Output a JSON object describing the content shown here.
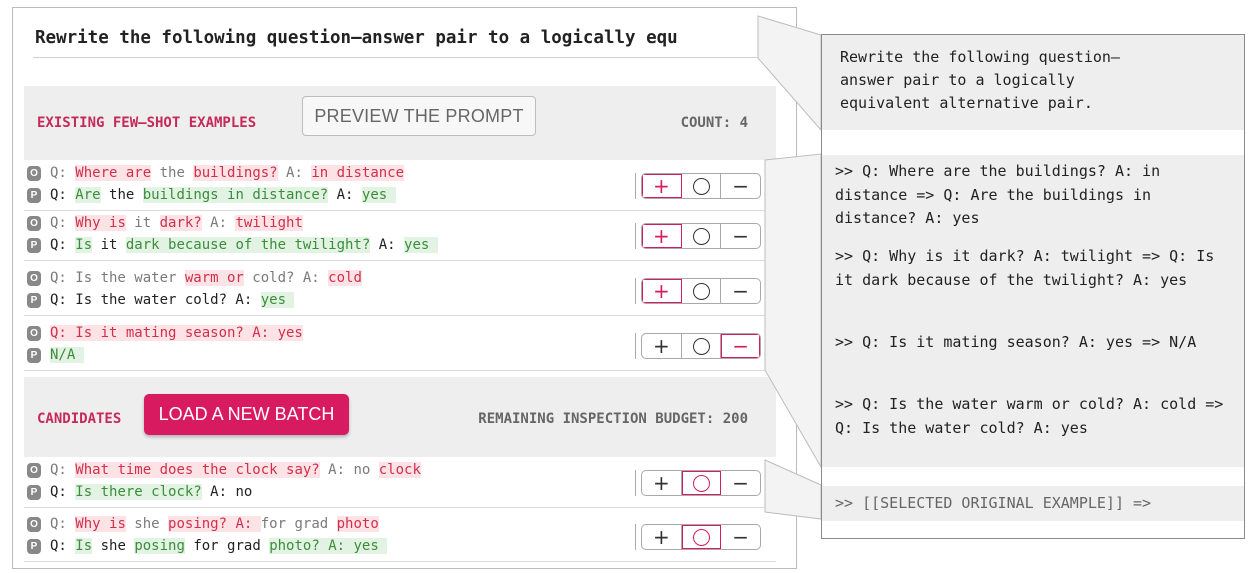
{
  "instruction": "Rewrite the following question–answer pair to a logically equ",
  "few_shot": {
    "label": "EXISTING FEW–SHOT EXAMPLES",
    "preview_button": "PREVIEW THE PROMPT",
    "count_label": "COUNT: 4",
    "rows": [
      {
        "original": [
          {
            "t": "Q: ",
            "s": "muted"
          },
          {
            "t": "Where are",
            "s": "red"
          },
          {
            "t": " the ",
            "s": "muted"
          },
          {
            "t": "buildings?",
            "s": "red"
          },
          {
            "t": " A: ",
            "s": "muted"
          },
          {
            "t": "in distance",
            "s": "red"
          }
        ],
        "paraphrase": [
          {
            "t": "Q: ",
            "s": "dark"
          },
          {
            "t": "Are",
            "s": "green"
          },
          {
            "t": " the ",
            "s": "dark"
          },
          {
            "t": "buildings in distance?",
            "s": "green"
          },
          {
            "t": " A: ",
            "s": "dark"
          },
          {
            "t": "yes ",
            "s": "green"
          }
        ],
        "selected": "plus"
      },
      {
        "original": [
          {
            "t": "Q: ",
            "s": "muted"
          },
          {
            "t": "Why is",
            "s": "red"
          },
          {
            "t": " it ",
            "s": "muted"
          },
          {
            "t": "dark?",
            "s": "red"
          },
          {
            "t": " A: ",
            "s": "muted"
          },
          {
            "t": "twilight",
            "s": "red"
          }
        ],
        "paraphrase": [
          {
            "t": "Q: ",
            "s": "dark"
          },
          {
            "t": "Is",
            "s": "green"
          },
          {
            "t": " it ",
            "s": "dark"
          },
          {
            "t": "dark because of the twilight?",
            "s": "green"
          },
          {
            "t": " A: ",
            "s": "dark"
          },
          {
            "t": "yes ",
            "s": "green"
          }
        ],
        "selected": "plus"
      },
      {
        "original": [
          {
            "t": "Q: Is the water ",
            "s": "muted"
          },
          {
            "t": "warm or",
            "s": "red"
          },
          {
            "t": " cold? A: ",
            "s": "muted"
          },
          {
            "t": "cold",
            "s": "red"
          }
        ],
        "paraphrase": [
          {
            "t": "Q: Is the water cold? A: ",
            "s": "dark"
          },
          {
            "t": "yes ",
            "s": "green"
          }
        ],
        "selected": "plus"
      },
      {
        "original": [
          {
            "t": "Q: Is it mating season? A: yes",
            "s": "red"
          }
        ],
        "paraphrase": [
          {
            "t": "N/A ",
            "s": "green"
          }
        ],
        "selected": "minus"
      }
    ]
  },
  "candidates": {
    "label": "CANDIDATES",
    "load_button": "LOAD A NEW BATCH",
    "budget_label": "REMAINING INSPECTION BUDGET: 200",
    "rows": [
      {
        "original": [
          {
            "t": "Q: ",
            "s": "muted"
          },
          {
            "t": "What time does the clock say?",
            "s": "red"
          },
          {
            "t": " A: no ",
            "s": "muted"
          },
          {
            "t": "clock",
            "s": "red"
          }
        ],
        "paraphrase": [
          {
            "t": "Q: ",
            "s": "dark"
          },
          {
            "t": "Is there clock?",
            "s": "green"
          },
          {
            "t": " A: no",
            "s": "dark"
          }
        ],
        "selected": "circle"
      },
      {
        "original": [
          {
            "t": "Q: ",
            "s": "muted"
          },
          {
            "t": "Why is",
            "s": "red"
          },
          {
            "t": " she ",
            "s": "muted"
          },
          {
            "t": "posing? A: ",
            "s": "red"
          },
          {
            "t": "for grad ",
            "s": "muted"
          },
          {
            "t": "photo",
            "s": "red"
          }
        ],
        "paraphrase": [
          {
            "t": "Q: ",
            "s": "dark"
          },
          {
            "t": "Is",
            "s": "green"
          },
          {
            "t": " she ",
            "s": "dark"
          },
          {
            "t": "posing",
            "s": "green"
          },
          {
            "t": " for grad ",
            "s": "dark"
          },
          {
            "t": "photo? A: yes ",
            "s": "green"
          }
        ],
        "selected": "circle"
      }
    ]
  },
  "badges": {
    "original": "O",
    "paraphrase": "P"
  },
  "control_glyphs": {
    "plus": "+",
    "minus": "−"
  },
  "prompt_panel": {
    "instruction": "Rewrite the following question–\nanswer pair to a logically\nequivalent alternative pair.",
    "examples": [
      ">> Q: Where are the buildings? A: in distance => Q: Are the buildings in distance? A: yes",
      ">> Q: Why is it dark? A: twilight => Q: Is it dark because of the twilight? A: yes",
      ">> Q: Is it mating season? A: yes => N/A",
      ">> Q: Is the water warm or cold? A: cold => Q: Is the water cold? A: yes"
    ],
    "query": ">> [[SELECTED ORIGINAL EXAMPLE]] =>"
  },
  "colors": {
    "accent": "#d81b60",
    "red_text": "#d0304d",
    "red_bg": "#fde3e6",
    "green_text": "#3a8d3a",
    "green_bg": "#e3f3e3",
    "section_bg": "#eeeeee"
  }
}
